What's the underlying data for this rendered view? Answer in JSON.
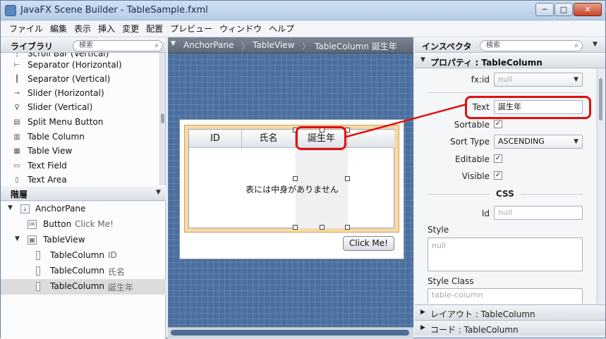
{
  "window": {
    "title": "JavaFX Scene Builder - TableSample.fxml",
    "min": "─",
    "max": "□",
    "close": "✕"
  },
  "menu": [
    "ファイル",
    "編集",
    "表示",
    "挿入",
    "変更",
    "配置",
    "プレビュー",
    "ウィンドウ",
    "ヘルプ"
  ],
  "library": {
    "title": "ライブラリ",
    "search_placeholder": "検索",
    "items": [
      {
        "label": "Scroll Bar (Vertical)",
        "icon": "scrollbar-icon",
        "glyph": "┆"
      },
      {
        "label": "Separator (Horizontal)",
        "icon": "separator-h-icon",
        "glyph": "⊢"
      },
      {
        "label": "Separator (Vertical)",
        "icon": "separator-v-icon",
        "glyph": "┃"
      },
      {
        "label": "Slider (Horizontal)",
        "icon": "slider-h-icon",
        "glyph": "⊸"
      },
      {
        "label": "Slider (Vertical)",
        "icon": "slider-v-icon",
        "glyph": "♀"
      },
      {
        "label": "Split Menu Button",
        "icon": "split-menu-icon",
        "glyph": "▤"
      },
      {
        "label": "Table Column",
        "icon": "table-column-icon",
        "glyph": "▥"
      },
      {
        "label": "Table View",
        "icon": "table-view-icon",
        "glyph": "▦"
      },
      {
        "label": "Text Field",
        "icon": "text-field-icon",
        "glyph": "▭"
      },
      {
        "label": "Text Area",
        "icon": "text-area-icon",
        "glyph": "▯"
      }
    ]
  },
  "hierarchy": {
    "title": "階層",
    "rows": [
      {
        "label": "AnchorPane",
        "sub": "",
        "glyph": "⤓"
      },
      {
        "label": "Button",
        "sub": "Click Me!",
        "glyph": "OK"
      },
      {
        "label": "TableView",
        "sub": "",
        "glyph": "▦"
      },
      {
        "label": "TableColumn",
        "sub": "ID",
        "glyph": ""
      },
      {
        "label": "TableColumn",
        "sub": "氏名",
        "glyph": ""
      },
      {
        "label": "TableColumn",
        "sub": "誕生年",
        "glyph": ""
      }
    ],
    "expand": "▼"
  },
  "breadcrumb": {
    "items": [
      "AnchorPane",
      "TableView",
      "TableColumn 誕生年"
    ],
    "sep": "〉"
  },
  "canvas": {
    "columns": [
      "ID",
      "氏名",
      "誕生年"
    ],
    "placeholder": "表には中身がありません",
    "button": "Click Me!"
  },
  "inspector": {
    "title": "インスペクタ",
    "search_placeholder": "検索",
    "properties_header": "プロパティ : TableColumn",
    "fxid_label": "fx:id",
    "fxid_placeholder": "null",
    "text_label": "Text",
    "text_value": "誕生年",
    "sortable_label": "Sortable",
    "sorttype_label": "Sort Type",
    "sorttype_value": "ASCENDING",
    "editable_label": "Editable",
    "visible_label": "Visible",
    "checked": "✓",
    "css_header": "CSS",
    "id_label": "Id",
    "id_placeholder": "null",
    "style_label": "Style",
    "style_placeholder": "null",
    "styleclass_label": "Style Class",
    "styleclass_value": "table-column",
    "layout_header": "レイアウト : TableColumn",
    "code_header": "コード : TableColumn",
    "collapsed": "▶",
    "expanded": "▼",
    "dropdown": "▼"
  },
  "colors": {
    "accent_red": "#e01010",
    "canvas_blue": "#4a6f9f",
    "tableview_border": "#f7d9a6"
  }
}
